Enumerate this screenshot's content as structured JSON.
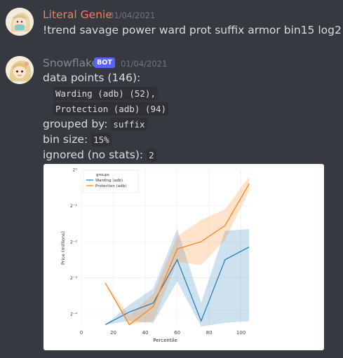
{
  "messages": [
    {
      "author": "Literal Genie",
      "author_color": "#f47b67",
      "timestamp": "01/04/2021",
      "content": "!trend savage power ward prot suffix armor bin15 log2"
    },
    {
      "author": "Snowflake",
      "author_color": "#7f8c9a",
      "bot_tag": "BOT",
      "timestamp": "01/04/2021",
      "lines": {
        "data_points_label": "data points (146):",
        "warding": "Warding (adb) (52),",
        "protection": "Protection (adb) (94)",
        "grouped_by_label": "grouped by:",
        "grouped_by_value": "suffix",
        "bin_size_label": "bin size:",
        "bin_size_value": "15%",
        "ignored_label": "ignored (no stats):",
        "ignored_value": "2"
      }
    }
  ],
  "chart_data": {
    "type": "line",
    "xlabel": "Percentile",
    "ylabel": "Price (millions)",
    "y_scale": "log2",
    "xlim": [
      0,
      105
    ],
    "ylim_log2": [
      -4.35,
      0
    ],
    "x_ticks": [
      0,
      20,
      40,
      60,
      80,
      100
    ],
    "x_tick_labels": [
      "0",
      "20",
      "40",
      "60",
      "80",
      "100"
    ],
    "y_ticks_log2": [
      0,
      -1,
      -2,
      -3,
      -4
    ],
    "y_tick_labels": [
      "2⁰",
      "2⁻¹",
      "2⁻²",
      "2⁻³",
      "2⁻⁴"
    ],
    "legend_title": "groups",
    "legend_position": "top-left",
    "series": [
      {
        "name": "Warding (adb)",
        "color": "#1f77b4",
        "x": [
          15,
          30,
          45,
          60,
          75,
          90,
          105
        ],
        "y_log2": [
          -4.3,
          -3.95,
          -3.7,
          -2.5,
          -4.2,
          -2.5,
          -2.15
        ],
        "band_upper_log2": [
          -4.3,
          -3.75,
          -3.3,
          -1.65,
          -3.7,
          -1.7,
          -1.65
        ],
        "band_lower_log2": [
          -4.3,
          -4.2,
          -4.25,
          -3.1,
          -4.35,
          -4.25,
          -4.2
        ]
      },
      {
        "name": "Protection (adb)",
        "color": "#ff7f0e",
        "x": [
          15,
          30,
          45,
          60,
          75,
          90,
          105
        ],
        "y_log2": [
          -3.15,
          -4.3,
          -3.8,
          -2.2,
          -2.0,
          -1.55,
          -0.4
        ],
        "band_upper_log2": [
          -3.15,
          -4.05,
          -3.45,
          -1.85,
          -1.4,
          -1.1,
          -0.2
        ],
        "band_lower_log2": [
          -3.15,
          -4.3,
          -4.2,
          -2.55,
          -2.65,
          -1.95,
          -0.6
        ]
      }
    ]
  }
}
